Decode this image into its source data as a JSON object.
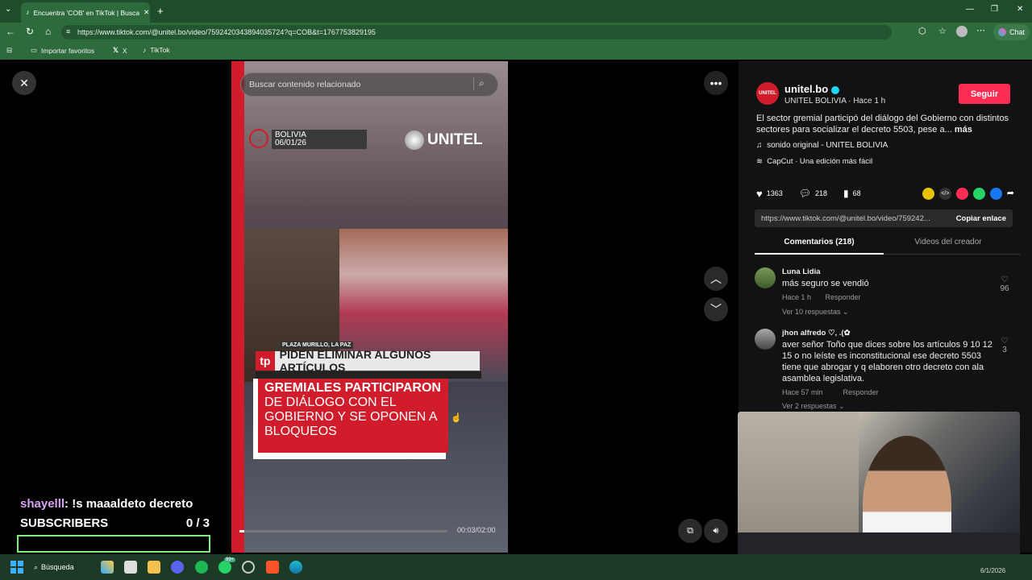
{
  "browser": {
    "tab_title": "Encuentra 'COB' en TikTok | Busca",
    "url": "https://www.tiktok.com/@unitel.bo/video/7592420343894035724?q=COB&t=1767753829195",
    "chat_label": "Chat",
    "favorites": [
      {
        "label": "Importar favoritos"
      },
      {
        "label": "X"
      },
      {
        "label": "TikTok"
      }
    ]
  },
  "video": {
    "search_placeholder": "Buscar contenido relacionado",
    "country": "BOLIVIA",
    "date": "06/01/26",
    "logo_text": "UNITEL",
    "place": "PLAZA MURILLO, LA PAZ",
    "channel_tag": "tp",
    "headline": "PIDEN ELIMINAR ALGUNOS ARTÍCULOS",
    "card_bold": "GREMIALES PARTICIPARON",
    "card_rest": "DE DIÁLOGO CON EL GOBIERNO Y SE OPONEN A BLOQUEOS",
    "time": "00:03/02:00",
    "progress": 0.025
  },
  "panel": {
    "username": "unitel.bo",
    "display": "UNITEL BOLIVIA · Hace 1 h",
    "follow": "Seguir",
    "description": "El sector gremial participó del diálogo del Gobierno con distintos sectores para socializar el decreto 5503, pese a...",
    "more": "más",
    "sound": "sonido original - UNITEL BOLIVIA",
    "capcut": "CapCut · Una edición más fácil",
    "likes": "1363",
    "comments_count": "218",
    "saves": "68",
    "link": "https://www.tiktok.com/@unitel.bo/video/759242...",
    "copy_label": "Copiar enlace",
    "tab_comments": "Comentarios (218)",
    "tab_videos": "Videos del creador",
    "comments": [
      {
        "name": "Luna Lidia",
        "text": "más seguro se vendió",
        "time": "Hace 1 h",
        "reply": "Responder",
        "likes": "96",
        "replies": "Ver 10 respuestas"
      },
      {
        "name": "jhon alfredo ♡, .(✿",
        "text": "aver señor Toño que dices sobre los artículos 9 10 12 15 o no leíste es inconstitucional ese decreto 5503 tiene que abrogar y q elaboren otro decreto con ala asamblea legislativa.",
        "time": "Hace 57 min",
        "reply": "Responder",
        "likes": "3",
        "replies": "Ver 2 respuestas"
      }
    ]
  },
  "overlay": {
    "chat_user": "shayelll",
    "chat_msg": ": !s maaaldeto decreto",
    "subs_label": "SUBSCRIBERS",
    "subs_value": "0  / 3"
  },
  "taskbar": {
    "search": "Búsqueda",
    "badge": "99+",
    "date": "6/1/2026"
  },
  "colors": {
    "accent": "#fe2c55",
    "unitel_red": "#d01c2b",
    "browser_green": "#2e6b3c"
  }
}
